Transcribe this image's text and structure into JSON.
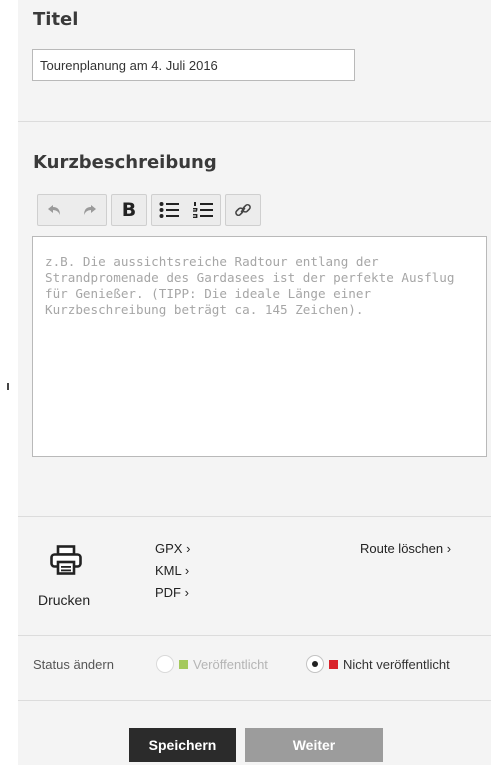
{
  "title_section": {
    "heading": "Titel",
    "value": "Tourenplanung am 4. Juli 2016"
  },
  "description_section": {
    "heading": "Kurzbeschreibung",
    "placeholder": "z.B. Die aussichtsreiche Radtour entlang der Strandpromenade des Gardasees ist der perfekte Ausflug für Genießer. (TIPP: Die ideale Länge einer Kurzbeschreibung beträgt ca. 145 Zeichen).",
    "toolbar": {
      "bold_label": "B",
      "icons": [
        "undo-icon",
        "redo-icon",
        "bold-icon",
        "bullet-list-icon",
        "numbered-list-icon",
        "link-icon"
      ]
    }
  },
  "actions": {
    "print_label": "Drucken",
    "print_icon": "printer-icon",
    "exports": [
      "GPX ›",
      "KML ›",
      "PDF ›"
    ],
    "delete_route": "Route löschen ›"
  },
  "status": {
    "label": "Status ändern",
    "options": [
      {
        "label": "Veröffentlicht",
        "color": "#a4c95c",
        "selected": false
      },
      {
        "label": "Nicht veröffentlicht",
        "color": "#d9232a",
        "selected": true
      }
    ]
  },
  "buttons": {
    "save": "Speichern",
    "next": "Weiter"
  }
}
